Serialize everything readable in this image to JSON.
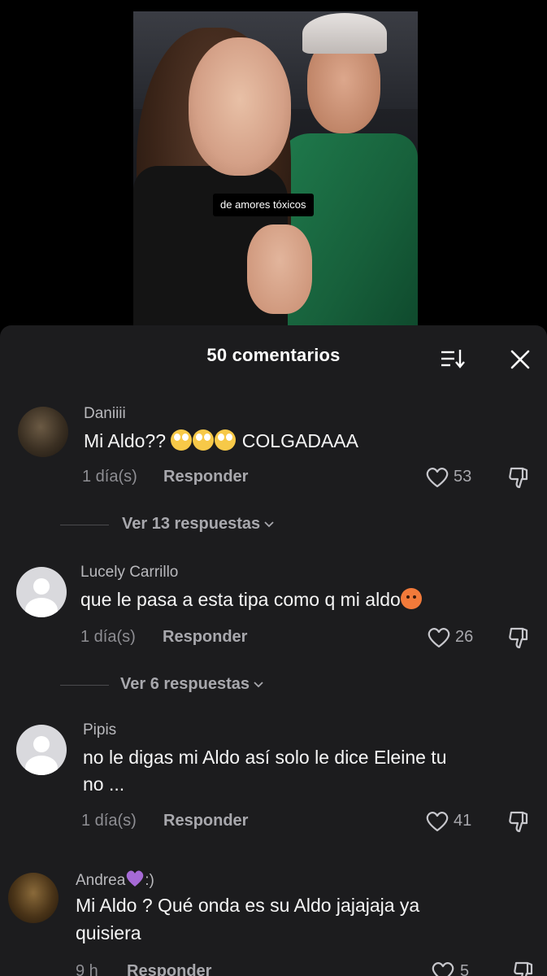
{
  "video": {
    "caption": "de amores tóxicos"
  },
  "header": {
    "title": "50 comentarios"
  },
  "comments": [
    {
      "username": "Daniiii",
      "text_before": "Mi Aldo?? ",
      "text_after": " COLGADAAA",
      "time": "1 día(s)",
      "reply_label": "Responder",
      "likes": "53",
      "view_replies": "Ver 13 respuestas"
    },
    {
      "username": "Lucely Carrillo",
      "text_before": "que le pasa a esta tipa como q mi aldo",
      "time": "1 día(s)",
      "reply_label": "Responder",
      "likes": "26",
      "view_replies": "Ver 6 respuestas"
    },
    {
      "username": "Pipis",
      "text_line1": "no le digas mi Aldo así solo le dice Eleine tu",
      "text_line2": "no ...",
      "time": "1 día(s)",
      "reply_label": "Responder",
      "likes": "41"
    },
    {
      "username_before": "Andrea",
      "username_after": ":)",
      "text_line1": "Mi Aldo ? Qué onda es su Aldo jajajaja ya",
      "text_line2": "quisiera",
      "time": "9 h",
      "reply_label": "Responder",
      "likes": "5"
    }
  ],
  "icons": {
    "like": "heart-outline-icon",
    "dislike": "thumbs-down-icon",
    "sort": "sort-icon",
    "close": "close-icon"
  },
  "colors": {
    "sheet_bg": "#1c1c1e",
    "text_primary": "#f5f5f5",
    "text_secondary": "#8e8e93"
  }
}
